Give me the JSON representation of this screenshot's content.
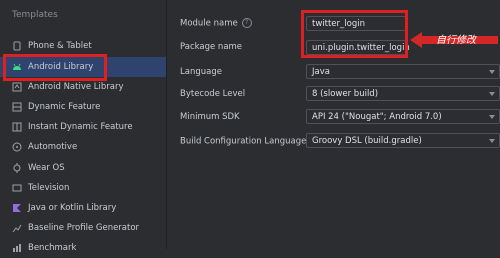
{
  "sidebar": {
    "title": "Templates",
    "items": [
      {
        "label": "Phone & Tablet",
        "icon": "phone-tablet-icon"
      },
      {
        "label": "Android Library",
        "icon": "android-icon"
      },
      {
        "label": "Android Native Library",
        "icon": "native-library-icon"
      },
      {
        "label": "Dynamic Feature",
        "icon": "dynamic-feature-icon"
      },
      {
        "label": "Instant Dynamic Feature",
        "icon": "instant-dynamic-feature-icon"
      },
      {
        "label": "Automotive",
        "icon": "automotive-icon"
      },
      {
        "label": "Wear OS",
        "icon": "wear-os-icon"
      },
      {
        "label": "Television",
        "icon": "television-icon"
      },
      {
        "label": "Java or Kotlin Library",
        "icon": "java-kotlin-icon"
      },
      {
        "label": "Baseline Profile Generator",
        "icon": "baseline-profile-icon"
      },
      {
        "label": "Benchmark",
        "icon": "benchmark-icon"
      }
    ]
  },
  "form": {
    "module_name_label": "Module name",
    "module_name_value": "twitter_login",
    "package_name_label": "Package name",
    "package_name_value": "uni.plugin.twitter_login",
    "language_label": "Language",
    "language_value": "Java",
    "bytecode_label": "Bytecode Level",
    "bytecode_value": "8 (slower build)",
    "min_sdk_label": "Minimum SDK",
    "min_sdk_value": "API 24 (\"Nougat\"; Android 7.0)",
    "build_config_label": "Build Configuration Language",
    "build_config_value": "Groovy DSL (build.gradle)"
  },
  "annotation": {
    "text": "自行修改"
  },
  "colors": {
    "highlight": "#e02020",
    "selected": "#2e436e",
    "android_green": "#3ddc84"
  }
}
